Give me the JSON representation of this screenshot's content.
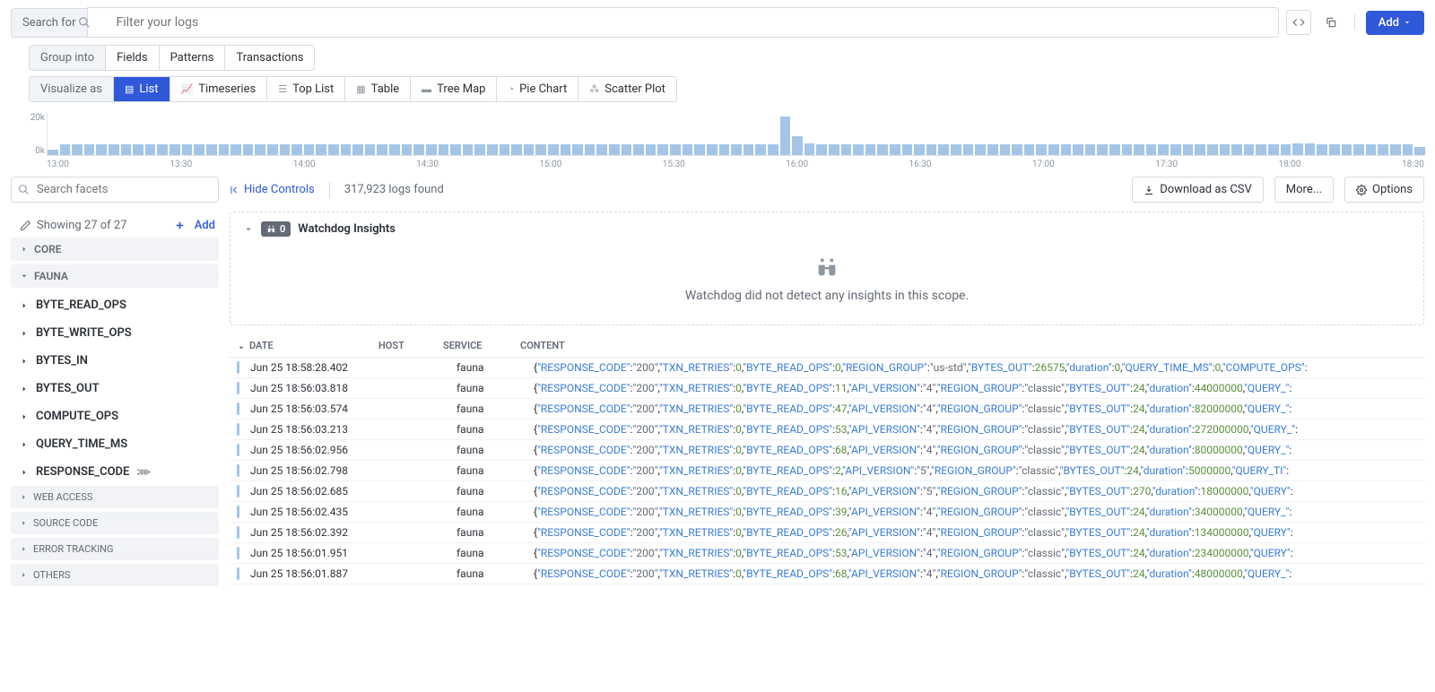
{
  "search": {
    "label": "Search for",
    "placeholder": "Filter your logs"
  },
  "addBtn": "Add",
  "group": {
    "label": "Group into",
    "items": [
      "Fields",
      "Patterns",
      "Transactions"
    ]
  },
  "viz": {
    "label": "Visualize as",
    "items": [
      "List",
      "Timeseries",
      "Top List",
      "Table",
      "Tree Map",
      "Pie Chart",
      "Scatter Plot"
    ]
  },
  "chart_data": {
    "type": "bar",
    "ylabel": "",
    "xlabel": "",
    "ytick_top": "20k",
    "ytick_bottom": "0k",
    "ylim": [
      0,
      20000
    ],
    "x_ticks": [
      "13:00",
      "13:30",
      "14:00",
      "14:30",
      "15:00",
      "15:30",
      "16:00",
      "16:30",
      "17:00",
      "17:30",
      "18:00",
      "18:30"
    ],
    "values": [
      2400,
      5200,
      5000,
      5200,
      5000,
      5000,
      5000,
      5000,
      5000,
      5000,
      5000,
      5000,
      5000,
      5000,
      5000,
      5000,
      5000,
      5000,
      5000,
      5000,
      5000,
      5000,
      5000,
      5000,
      5000,
      5000,
      5000,
      5000,
      5000,
      5000,
      5000,
      5000,
      5000,
      5000,
      5000,
      5000,
      5000,
      5000,
      5000,
      5000,
      5000,
      5000,
      5000,
      5000,
      5000,
      5000,
      5000,
      5000,
      5000,
      5000,
      5000,
      5000,
      5000,
      5000,
      5000,
      5000,
      5000,
      5000,
      5000,
      5000,
      18500,
      8800,
      5400,
      5000,
      5000,
      5000,
      5000,
      5000,
      5000,
      5000,
      5000,
      5000,
      5000,
      5000,
      5000,
      5000,
      5000,
      5000,
      5000,
      5000,
      5000,
      5000,
      5000,
      5000,
      5000,
      5000,
      5000,
      5000,
      5000,
      5000,
      5000,
      5000,
      5000,
      5000,
      5000,
      5000,
      5000,
      5000,
      5000,
      5000,
      5000,
      5000,
      5400,
      5400,
      5000,
      5200,
      5200,
      5200,
      5000,
      5000,
      5100,
      5100,
      4000
    ]
  },
  "facets": {
    "placeholder": "Search facets",
    "showing": "Showing 27 of 27",
    "add": "Add",
    "groups": [
      "CORE",
      "FAUNA"
    ],
    "items": [
      "BYTE_READ_OPS",
      "BYTE_WRITE_OPS",
      "BYTES_IN",
      "BYTES_OUT",
      "COMPUTE_OPS",
      "QUERY_TIME_MS",
      "RESPONSE_CODE"
    ],
    "other": [
      "WEB ACCESS",
      "SOURCE CODE",
      "ERROR TRACKING",
      "OTHERS"
    ]
  },
  "controls": {
    "hide": "Hide Controls",
    "count": "317,923 logs found",
    "csv": "Download as CSV",
    "more": "More...",
    "options": "Options"
  },
  "insights": {
    "badge": "0",
    "title": "Watchdog Insights",
    "empty": "Watchdog did not detect any insights in this scope."
  },
  "table": {
    "headers": {
      "date": "DATE",
      "host": "HOST",
      "service": "SERVICE",
      "content": "CONTENT"
    },
    "rows": [
      {
        "date": "Jun 25 18:58:28.402",
        "service": "fauna",
        "fields": [
          [
            "RESPONSE_CODE",
            "\"200\""
          ],
          [
            "TXN_RETRIES",
            "0"
          ],
          [
            "BYTE_READ_OPS",
            "0"
          ],
          [
            "REGION_GROUP",
            "\"us-std\""
          ],
          [
            "BYTES_OUT",
            "26575"
          ],
          [
            "duration",
            "0"
          ],
          [
            "QUERY_TIME_MS",
            "0"
          ],
          [
            "COMPUTE_OPS",
            ""
          ]
        ]
      },
      {
        "date": "Jun 25 18:56:03.818",
        "service": "fauna",
        "fields": [
          [
            "RESPONSE_CODE",
            "\"200\""
          ],
          [
            "TXN_RETRIES",
            "0"
          ],
          [
            "BYTE_READ_OPS",
            "11"
          ],
          [
            "API_VERSION",
            "\"4\""
          ],
          [
            "REGION_GROUP",
            "\"classic\""
          ],
          [
            "BYTES_OUT",
            "24"
          ],
          [
            "duration",
            "44000000"
          ],
          [
            "QUERY_",
            ""
          ]
        ]
      },
      {
        "date": "Jun 25 18:56:03.574",
        "service": "fauna",
        "fields": [
          [
            "RESPONSE_CODE",
            "\"200\""
          ],
          [
            "TXN_RETRIES",
            "0"
          ],
          [
            "BYTE_READ_OPS",
            "47"
          ],
          [
            "API_VERSION",
            "\"4\""
          ],
          [
            "REGION_GROUP",
            "\"classic\""
          ],
          [
            "BYTES_OUT",
            "24"
          ],
          [
            "duration",
            "82000000"
          ],
          [
            "QUERY_",
            ""
          ]
        ]
      },
      {
        "date": "Jun 25 18:56:03.213",
        "service": "fauna",
        "fields": [
          [
            "RESPONSE_CODE",
            "\"200\""
          ],
          [
            "TXN_RETRIES",
            "0"
          ],
          [
            "BYTE_READ_OPS",
            "53"
          ],
          [
            "API_VERSION",
            "\"4\""
          ],
          [
            "REGION_GROUP",
            "\"classic\""
          ],
          [
            "BYTES_OUT",
            "24"
          ],
          [
            "duration",
            "272000000"
          ],
          [
            "QUERY_",
            ""
          ]
        ]
      },
      {
        "date": "Jun 25 18:56:02.956",
        "service": "fauna",
        "fields": [
          [
            "RESPONSE_CODE",
            "\"200\""
          ],
          [
            "TXN_RETRIES",
            "0"
          ],
          [
            "BYTE_READ_OPS",
            "68"
          ],
          [
            "API_VERSION",
            "\"4\""
          ],
          [
            "REGION_GROUP",
            "\"classic\""
          ],
          [
            "BYTES_OUT",
            "24"
          ],
          [
            "duration",
            "80000000"
          ],
          [
            "QUERY_",
            ""
          ]
        ]
      },
      {
        "date": "Jun 25 18:56:02.798",
        "service": "fauna",
        "fields": [
          [
            "RESPONSE_CODE",
            "\"200\""
          ],
          [
            "TXN_RETRIES",
            "0"
          ],
          [
            "BYTE_READ_OPS",
            "2"
          ],
          [
            "API_VERSION",
            "\"5\""
          ],
          [
            "REGION_GROUP",
            "\"classic\""
          ],
          [
            "BYTES_OUT",
            "24"
          ],
          [
            "duration",
            "5000000"
          ],
          [
            "QUERY_TI",
            ""
          ]
        ]
      },
      {
        "date": "Jun 25 18:56:02.685",
        "service": "fauna",
        "fields": [
          [
            "RESPONSE_CODE",
            "\"200\""
          ],
          [
            "TXN_RETRIES",
            "0"
          ],
          [
            "BYTE_READ_OPS",
            "16"
          ],
          [
            "API_VERSION",
            "\"5\""
          ],
          [
            "REGION_GROUP",
            "\"classic\""
          ],
          [
            "BYTES_OUT",
            "270"
          ],
          [
            "duration",
            "18000000"
          ],
          [
            "QUERY",
            ""
          ]
        ]
      },
      {
        "date": "Jun 25 18:56:02.435",
        "service": "fauna",
        "fields": [
          [
            "RESPONSE_CODE",
            "\"200\""
          ],
          [
            "TXN_RETRIES",
            "0"
          ],
          [
            "BYTE_READ_OPS",
            "39"
          ],
          [
            "API_VERSION",
            "\"4\""
          ],
          [
            "REGION_GROUP",
            "\"classic\""
          ],
          [
            "BYTES_OUT",
            "24"
          ],
          [
            "duration",
            "34000000"
          ],
          [
            "QUERY_",
            ""
          ]
        ]
      },
      {
        "date": "Jun 25 18:56:02.392",
        "service": "fauna",
        "fields": [
          [
            "RESPONSE_CODE",
            "\"200\""
          ],
          [
            "TXN_RETRIES",
            "0"
          ],
          [
            "BYTE_READ_OPS",
            "26"
          ],
          [
            "API_VERSION",
            "\"4\""
          ],
          [
            "REGION_GROUP",
            "\"classic\""
          ],
          [
            "BYTES_OUT",
            "24"
          ],
          [
            "duration",
            "134000000"
          ],
          [
            "QUERY",
            ""
          ]
        ]
      },
      {
        "date": "Jun 25 18:56:01.951",
        "service": "fauna",
        "fields": [
          [
            "RESPONSE_CODE",
            "\"200\""
          ],
          [
            "TXN_RETRIES",
            "0"
          ],
          [
            "BYTE_READ_OPS",
            "53"
          ],
          [
            "API_VERSION",
            "\"4\""
          ],
          [
            "REGION_GROUP",
            "\"classic\""
          ],
          [
            "BYTES_OUT",
            "24"
          ],
          [
            "duration",
            "234000000"
          ],
          [
            "QUERY",
            ""
          ]
        ]
      },
      {
        "date": "Jun 25 18:56:01.887",
        "service": "fauna",
        "fields": [
          [
            "RESPONSE_CODE",
            "\"200\""
          ],
          [
            "TXN_RETRIES",
            "0"
          ],
          [
            "BYTE_READ_OPS",
            "68"
          ],
          [
            "API_VERSION",
            "\"4\""
          ],
          [
            "REGION_GROUP",
            "\"classic\""
          ],
          [
            "BYTES_OUT",
            "24"
          ],
          [
            "duration",
            "48000000"
          ],
          [
            "QUERY_",
            ""
          ]
        ]
      }
    ]
  }
}
